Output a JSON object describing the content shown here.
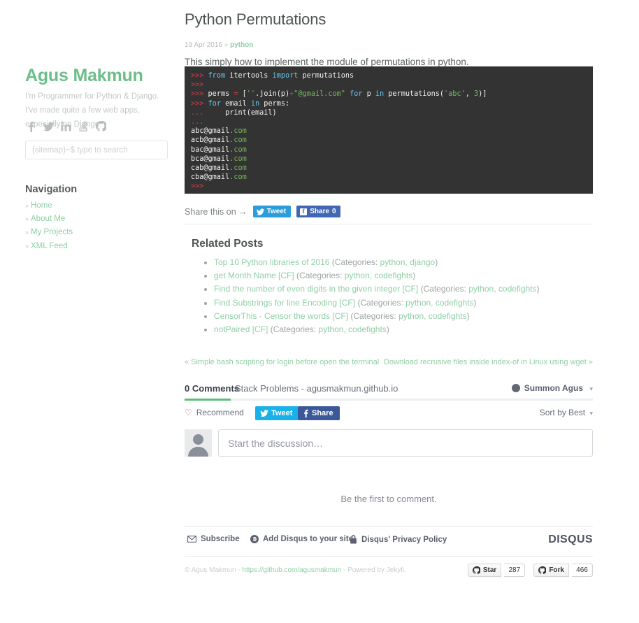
{
  "sidebar": {
    "title": "Agus Makmun",
    "description": "I'm Programmer for Python & Django. I've made quite a few web apps, especially on Django.",
    "social": [
      {
        "name": "facebook-icon",
        "label": "Facebook"
      },
      {
        "name": "twitter-icon",
        "label": "Twitter"
      },
      {
        "name": "linkedin-icon",
        "label": "LinkedIn"
      },
      {
        "name": "stackoverflow-icon",
        "label": "Stack Overflow"
      },
      {
        "name": "github-icon",
        "label": "GitHub"
      }
    ],
    "search_placeholder": "(sitemap)~$ type to search",
    "search_value": "",
    "nav_title": "Navigation",
    "nav_items": [
      {
        "label": "Home"
      },
      {
        "label": "About Me"
      },
      {
        "label": "My Projects"
      },
      {
        "label": "XML Feed"
      }
    ]
  },
  "post": {
    "title": "Python Permutations",
    "date": "19 Apr 2016",
    "bullet": "»",
    "tag": "python",
    "intro": "This simply how to implement the module of permutations in python.",
    "code": {
      "lines": [
        [
          [
            "c-prompt",
            ">>> "
          ],
          [
            "c-kw",
            "from"
          ],
          [
            "c-plain",
            " itertools "
          ],
          [
            "c-kw",
            "import"
          ],
          [
            "c-plain",
            " permutations"
          ]
        ],
        [
          [
            "c-prompt",
            ">>>"
          ]
        ],
        [
          [
            "c-prompt",
            ">>> "
          ],
          [
            "c-plain",
            "perms "
          ],
          [
            "c-op",
            "="
          ],
          [
            "c-plain",
            " ["
          ],
          [
            "c-str",
            "''"
          ],
          [
            "c-plain",
            "."
          ],
          [
            "c-fn",
            "join"
          ],
          [
            "c-plain",
            "(p)"
          ],
          [
            "c-op",
            "+"
          ],
          [
            "c-str",
            "\"@"
          ],
          [
            "c-green",
            "gmail.com"
          ],
          [
            "c-str",
            "\""
          ],
          [
            "c-plain",
            " "
          ],
          [
            "c-kw",
            "for"
          ],
          [
            "c-plain",
            " p "
          ],
          [
            "c-kw",
            "in"
          ],
          [
            "c-plain",
            " permutations("
          ],
          [
            "c-str",
            "'abc'"
          ],
          [
            "c-plain",
            ", "
          ],
          [
            "c-num",
            "3"
          ],
          [
            "c-plain",
            ")]"
          ]
        ],
        [
          [
            "c-prompt",
            ">>> "
          ],
          [
            "c-kw",
            "for"
          ],
          [
            "c-plain",
            " email "
          ],
          [
            "c-kw",
            "in"
          ],
          [
            "c-plain",
            " perms:"
          ]
        ],
        [
          [
            "c-prompt",
            "... "
          ],
          [
            "c-plain",
            "    print(email)"
          ]
        ],
        [
          [
            "c-prompt",
            "..."
          ]
        ],
        [
          [
            "c-plain",
            "abc@gmail"
          ],
          [
            "c-green",
            ".com"
          ]
        ],
        [
          [
            "c-plain",
            "acb@gmail"
          ],
          [
            "c-green",
            ".com"
          ]
        ],
        [
          [
            "c-plain",
            "bac@gmail"
          ],
          [
            "c-green",
            ".com"
          ]
        ],
        [
          [
            "c-plain",
            "bca@gmail"
          ],
          [
            "c-green",
            ".com"
          ]
        ],
        [
          [
            "c-plain",
            "cab@gmail"
          ],
          [
            "c-green",
            ".com"
          ]
        ],
        [
          [
            "c-plain",
            "cba@gmail"
          ],
          [
            "c-green",
            ".com"
          ]
        ],
        [
          [
            "c-prompt",
            ">>>"
          ]
        ]
      ]
    }
  },
  "share": {
    "label": "Share this on →",
    "tweet_label": "Tweet",
    "facebook_label": "Share",
    "facebook_count": "0"
  },
  "related": {
    "title": "Related Posts",
    "items": [
      {
        "title": "Top 10 Python libraries of 2016",
        "cat_prefix": " (Categories: ",
        "cats": "python, django",
        "cat_suffix": ")"
      },
      {
        "title": "get Month Name [CF]",
        "cat_prefix": " (Categories: ",
        "cats": "python, codefights",
        "cat_suffix": ")"
      },
      {
        "title": "Find the number of even digits in the given integer [CF]",
        "cat_prefix": " (Categories: ",
        "cats": "python, codefights",
        "cat_suffix": ")"
      },
      {
        "title": "Find Substrings for line Encoding [CF]",
        "cat_prefix": " (Categories: ",
        "cats": "python, codefights",
        "cat_suffix": ")"
      },
      {
        "title": "CensorThis - Censor the words [CF]",
        "cat_prefix": " (Categories: ",
        "cats": "python, codefights",
        "cat_suffix": ")"
      },
      {
        "title": "notPaired [CF]",
        "cat_prefix": " (Categories: ",
        "cats": "python, codefights",
        "cat_suffix": ")"
      }
    ]
  },
  "pagination": {
    "prev": "« Simple bash scripting for login before open the terminal",
    "next": "Download recrusive files inside index-of in Linux using wget »"
  },
  "disqus": {
    "comment_count": "0 Comments",
    "site_name": "Stack Problems - agusmakmun.github.io",
    "user": "Summon Agus",
    "user_caret": "▾",
    "recommend": "Recommend",
    "tweet": "Tweet",
    "share": "Share",
    "sort": "Sort by Best",
    "sort_caret": "▾",
    "compose_placeholder": "Start the discussion…",
    "compose_value": "",
    "empty_message": "Be the first to comment.",
    "footer": {
      "subscribe": "Subscribe",
      "add_site": "Add Disqus to your site",
      "privacy": "Disqus' Privacy Policy",
      "logo": "DISQUS"
    }
  },
  "footer": {
    "copyright_pre": "© Agus Makmun - ",
    "link": "https://github.com/agusmakmun",
    "copyright_post": " - Powered by Jekyll.",
    "star_label": "Star",
    "star_count": "287",
    "fork_label": "Fork",
    "fork_count": "466"
  },
  "colors": {
    "accent_green": "#8fcfa5",
    "title_green": "#6bbf88",
    "code_bg": "#333333",
    "twitter_blue": "#2b9ddb",
    "facebook_blue": "#4267b2"
  }
}
